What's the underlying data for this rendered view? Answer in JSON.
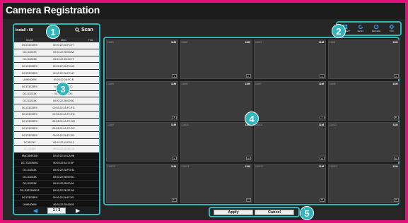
{
  "window": {
    "title": "Camera Registration"
  },
  "left_panel": {
    "total_label": "Install : 68",
    "scan_label": "Scan",
    "columns": [
      "Model",
      "MAC",
      "This"
    ],
    "rows": [
      {
        "model": "DC-D3233RX",
        "mac": "00:03:22:2A:FC:F7",
        "this": "",
        "style": "light"
      },
      {
        "model": "DC-D3233X",
        "mac": "00:03:22:2B:00:8A",
        "this": "",
        "style": "light"
      },
      {
        "model": "DC-D3233X",
        "mac": "00:03:22:2B:00:73",
        "this": "",
        "style": "light"
      },
      {
        "model": "DC-D3233RX",
        "mac": "00:03:22:2A:FC:A0",
        "this": "",
        "style": "light"
      },
      {
        "model": "DC-D3233RX",
        "mac": "00:03:22:2A:FC:A7",
        "this": "",
        "style": "light"
      },
      {
        "model": "UNKNOWN",
        "mac": "00:03:22:2A:FC:B",
        "this": "",
        "style": "light"
      },
      {
        "model": "DC-D3233RX",
        "mac": "00:03:22:2A:FC:",
        "this": "",
        "style": "light"
      },
      {
        "model": "DC-D3233X",
        "mac": "00:03:22:2B:00:",
        "this": "",
        "style": "light"
      },
      {
        "model": "DC-D3233X",
        "mac": "00:03:22:2B:00:9D",
        "this": "",
        "style": "light"
      },
      {
        "model": "DC-D3233RX",
        "mac": "00:03:22:2A:FC:FD",
        "this": "",
        "style": "light"
      },
      {
        "model": "DC-D3233RX",
        "mac": "00:03:22:2A:FC:ED",
        "this": "",
        "style": "light"
      },
      {
        "model": "DC-D3233RX",
        "mac": "00:03:22:2A:FC:DD",
        "this": "",
        "style": "light"
      },
      {
        "model": "DC-D3233RX",
        "mac": "00:03:22:2A:FC:DC",
        "this": "",
        "style": "light"
      },
      {
        "model": "DC-D3233RX",
        "mac": "00:03:22:2A:FC:D3",
        "this": "",
        "style": "light"
      },
      {
        "model": "DC-B1243",
        "mac": "00:03:22:19:E0:13",
        "this": "",
        "style": "light"
      },
      {
        "model": "DC-V4263",
        "mac": "00:03:22:1D:B0:12",
        "this": "",
        "style": "dim"
      },
      {
        "model": "MAC3B9CDB",
        "mac": "00:03:22:34:CA:9B",
        "this": "",
        "style": "dark"
      },
      {
        "model": "DC-T3233WXL",
        "mac": "00:03:22:34:17:5F",
        "this": "",
        "style": "dark"
      },
      {
        "model": "DC-D3233X",
        "mac": "00:03:22:2A:FD:43",
        "this": "",
        "style": "dark"
      },
      {
        "model": "DC-D3233X",
        "mac": "00:03:22:2B:00:6C",
        "this": "",
        "style": "dark"
      },
      {
        "model": "DC-D3233X",
        "mac": "00:03:22:2B:00:A1",
        "this": "",
        "style": "dark"
      },
      {
        "model": "DC-D3233WRXF",
        "mac": "00:03:22:2E:2E:A0",
        "this": "",
        "style": "dark"
      },
      {
        "model": "DC-D3233RX",
        "mac": "00:03:22:2A:FC:E1",
        "this": "",
        "style": "dark"
      },
      {
        "model": "UNKNOWN",
        "mac": "00:03:22:2B:00:03",
        "this": "",
        "style": "dark"
      }
    ],
    "page_label": "1 / 3"
  },
  "toolbar": {
    "items": [
      {
        "label": "ALIGNMENT",
        "icon": "grid-icon"
      },
      {
        "label": "RESET",
        "icon": "reset-icon"
      },
      {
        "label": "REFRESH",
        "icon": "refresh-icon"
      },
      {
        "label": "TOOL",
        "icon": "gear-icon"
      }
    ]
  },
  "grid": {
    "cameras": [
      {
        "name": "CAM1",
        "res": "11M",
        "num": "1"
      },
      {
        "name": "CAM2",
        "res": "11M",
        "num": "2"
      },
      {
        "name": "CAM3",
        "res": "11M",
        "num": "3"
      },
      {
        "name": "CAM4",
        "res": "11M",
        "num": "4"
      },
      {
        "name": "CAM5",
        "res": "11M",
        "num": "5"
      },
      {
        "name": "CAM6",
        "res": "11M",
        "num": "6"
      },
      {
        "name": "CAM7",
        "res": "11M",
        "num": "7"
      },
      {
        "name": "CAM8",
        "res": "11M",
        "num": "8"
      },
      {
        "name": "CAM9",
        "res": "11M",
        "num": "9"
      },
      {
        "name": "CAM10",
        "res": "11M",
        "num": "10"
      },
      {
        "name": "CAM11",
        "res": "11M",
        "num": "11"
      },
      {
        "name": "CAM12",
        "res": "11M",
        "num": "12"
      },
      {
        "name": "CAM13",
        "res": "11M",
        "num": "13"
      },
      {
        "name": "CAM14",
        "res": "11M",
        "num": "14"
      },
      {
        "name": "CAM15",
        "res": "11M",
        "num": "15"
      },
      {
        "name": "CAM16",
        "res": "11M",
        "num": "16"
      }
    ]
  },
  "actions": {
    "apply": "Apply",
    "cancel": "Cancel"
  },
  "badges": [
    "1",
    "2",
    "3",
    "4",
    "5"
  ],
  "colors": {
    "frame": "#e0127a",
    "accent": "#2fb6bd",
    "icon": "#2aa7e8"
  }
}
